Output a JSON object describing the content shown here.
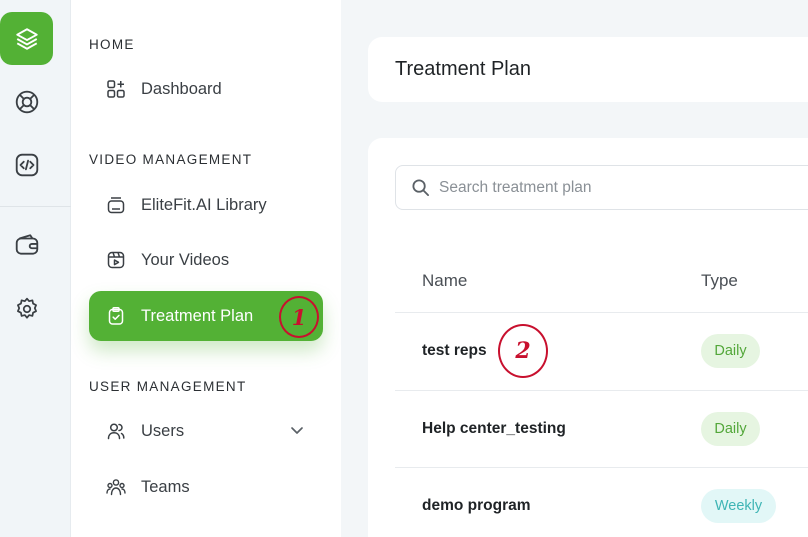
{
  "colors": {
    "accent": "#53b135",
    "annotation": "#c8102e",
    "daily_badge": "#53a73a",
    "weekly_badge": "#3fb5b5"
  },
  "rail": {
    "items": [
      {
        "icon": "layers-icon",
        "active": true
      },
      {
        "icon": "lifebuoy-icon",
        "active": false
      },
      {
        "icon": "code-icon",
        "active": false
      },
      {
        "icon": "wallet-icon",
        "active": false
      },
      {
        "icon": "gear-icon",
        "active": false
      }
    ]
  },
  "sidebar": {
    "sections": [
      {
        "title": "HOME",
        "items": [
          {
            "label": "Dashboard",
            "icon": "dashboard-icon"
          }
        ]
      },
      {
        "title": "VIDEO MANAGEMENT",
        "items": [
          {
            "label": "EliteFit.AI Library",
            "icon": "library-icon"
          },
          {
            "label": "Your Videos",
            "icon": "video-icon"
          },
          {
            "label": "Treatment Plan",
            "icon": "clipboard-icon",
            "active": true
          }
        ]
      },
      {
        "title": "USER MANAGEMENT",
        "items": [
          {
            "label": "Users",
            "icon": "users-icon",
            "has_submenu": true
          },
          {
            "label": "Teams",
            "icon": "teams-icon"
          }
        ]
      }
    ]
  },
  "annotations": {
    "first": "1",
    "second": "2"
  },
  "main": {
    "page_title": "Treatment Plan",
    "search": {
      "placeholder": "Search treatment plan",
      "value": ""
    },
    "table": {
      "columns": [
        "Name",
        "Type"
      ],
      "rows": [
        {
          "name": "test reps",
          "type": "Daily"
        },
        {
          "name": "Help center_testing",
          "type": "Daily"
        },
        {
          "name": "demo program",
          "type": "Weekly"
        }
      ]
    }
  }
}
